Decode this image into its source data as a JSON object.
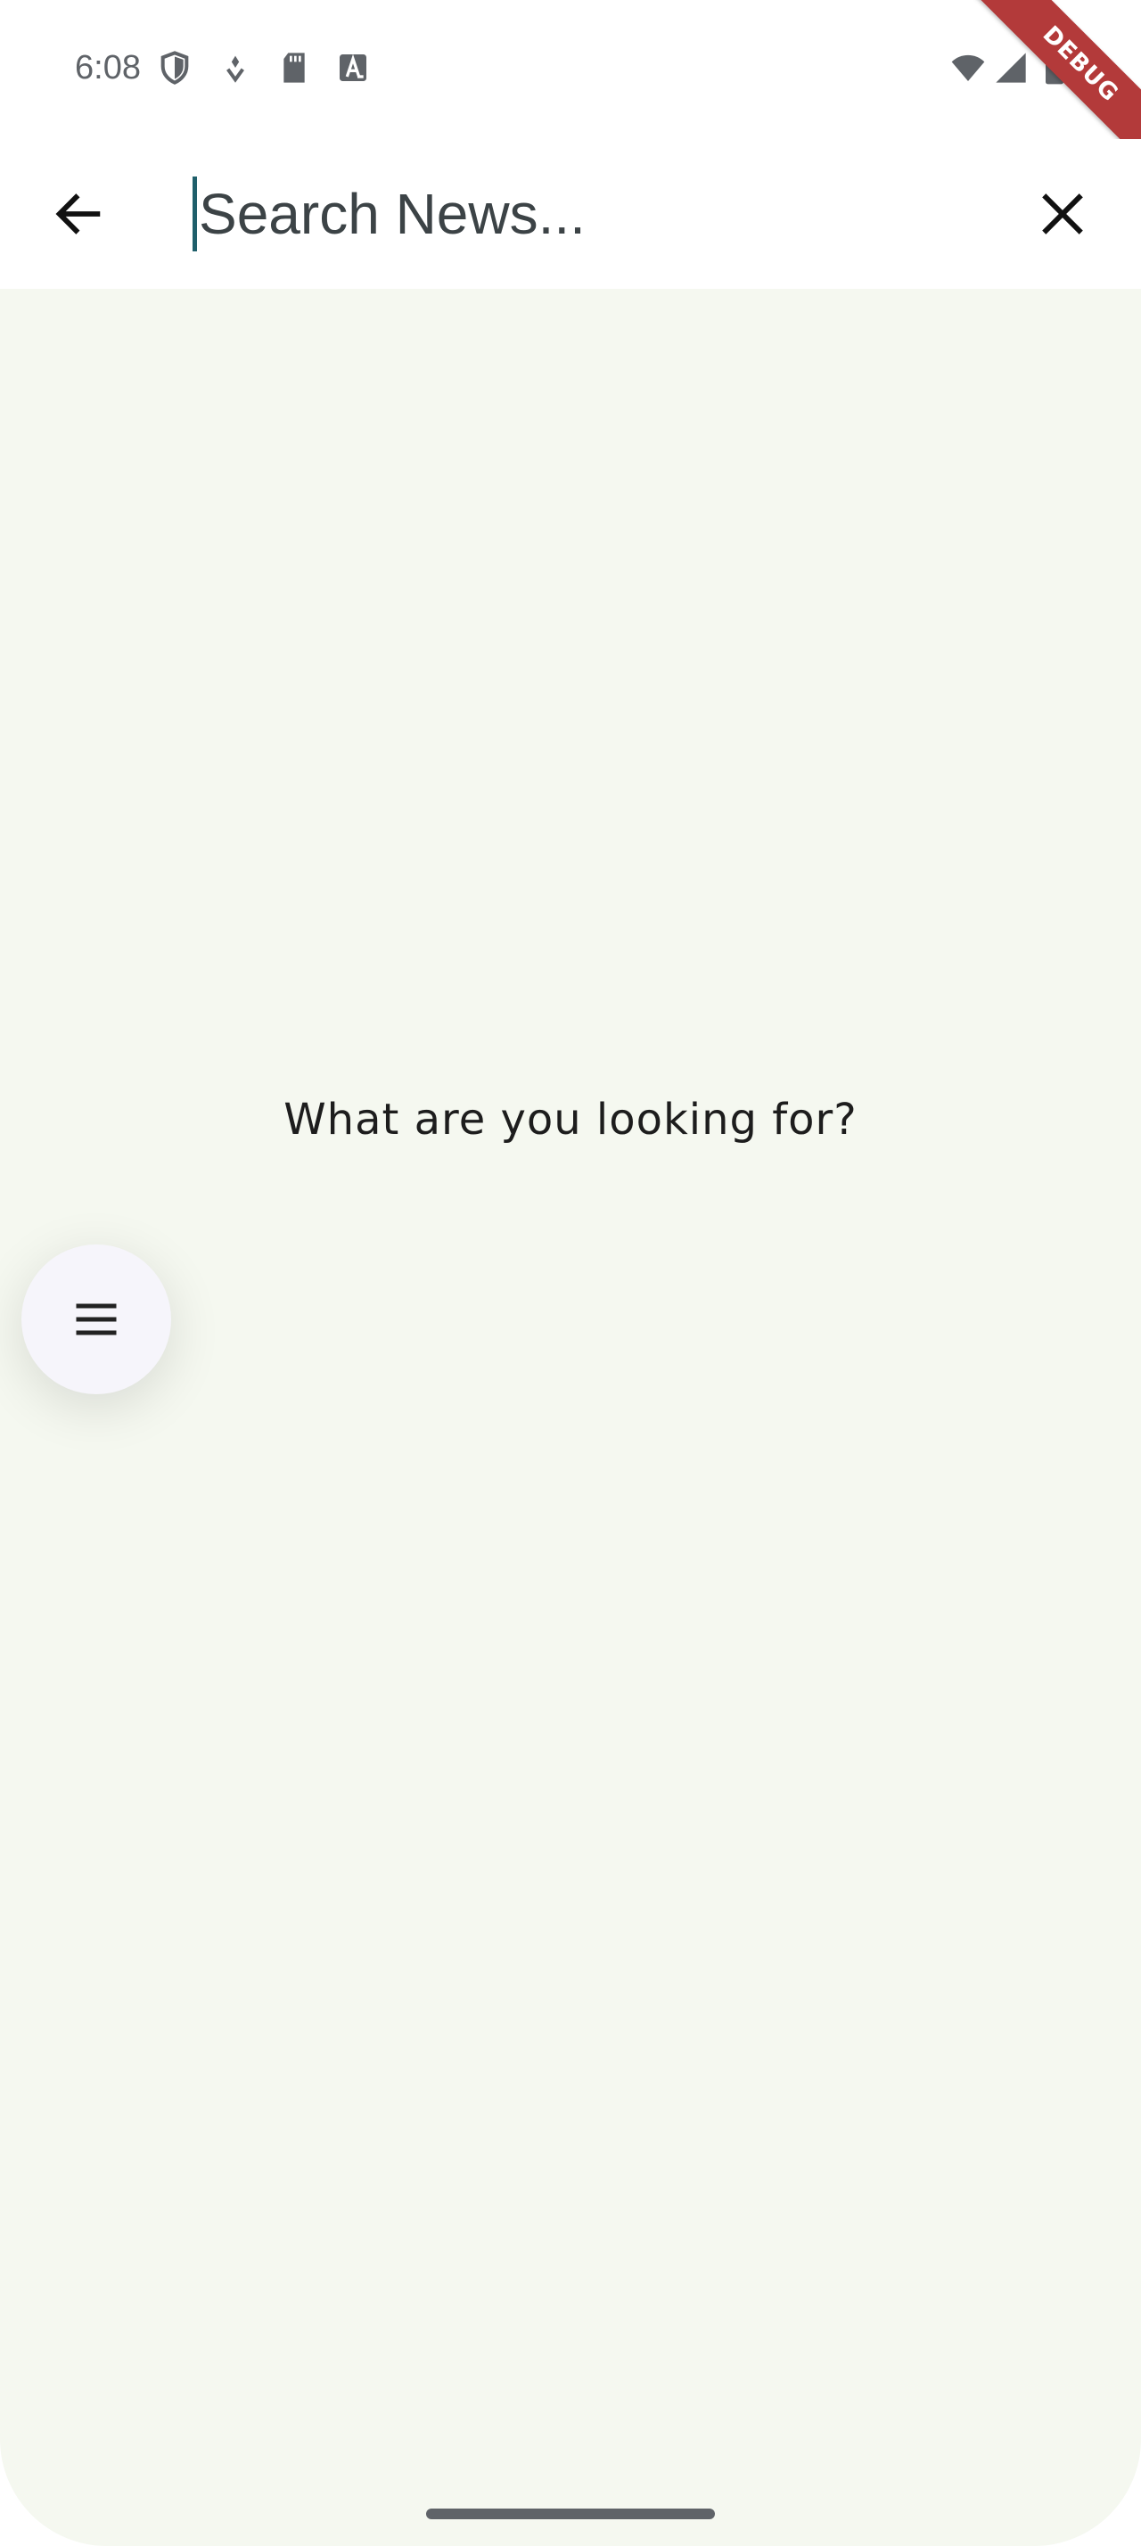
{
  "status_bar": {
    "time": "6:08",
    "left_icons": [
      "shield-icon",
      "location-dot-icon",
      "sd-card-icon",
      "a-badge-icon"
    ],
    "right_icons": [
      "wifi-icon",
      "signal-icon",
      "battery-icon"
    ]
  },
  "debug_banner": {
    "label": "DEBUG"
  },
  "search_bar": {
    "back_icon": "arrow-left-icon",
    "placeholder": "Search News...",
    "value": "",
    "clear_icon": "close-icon"
  },
  "main": {
    "empty_message": "What are you looking for?",
    "menu_icon": "hamburger-menu-icon"
  },
  "colors": {
    "background": "#f5f8f0",
    "caret": "#1f5f6b",
    "debug_ribbon": "#b33a3a",
    "fab": "#f6f5fb"
  }
}
